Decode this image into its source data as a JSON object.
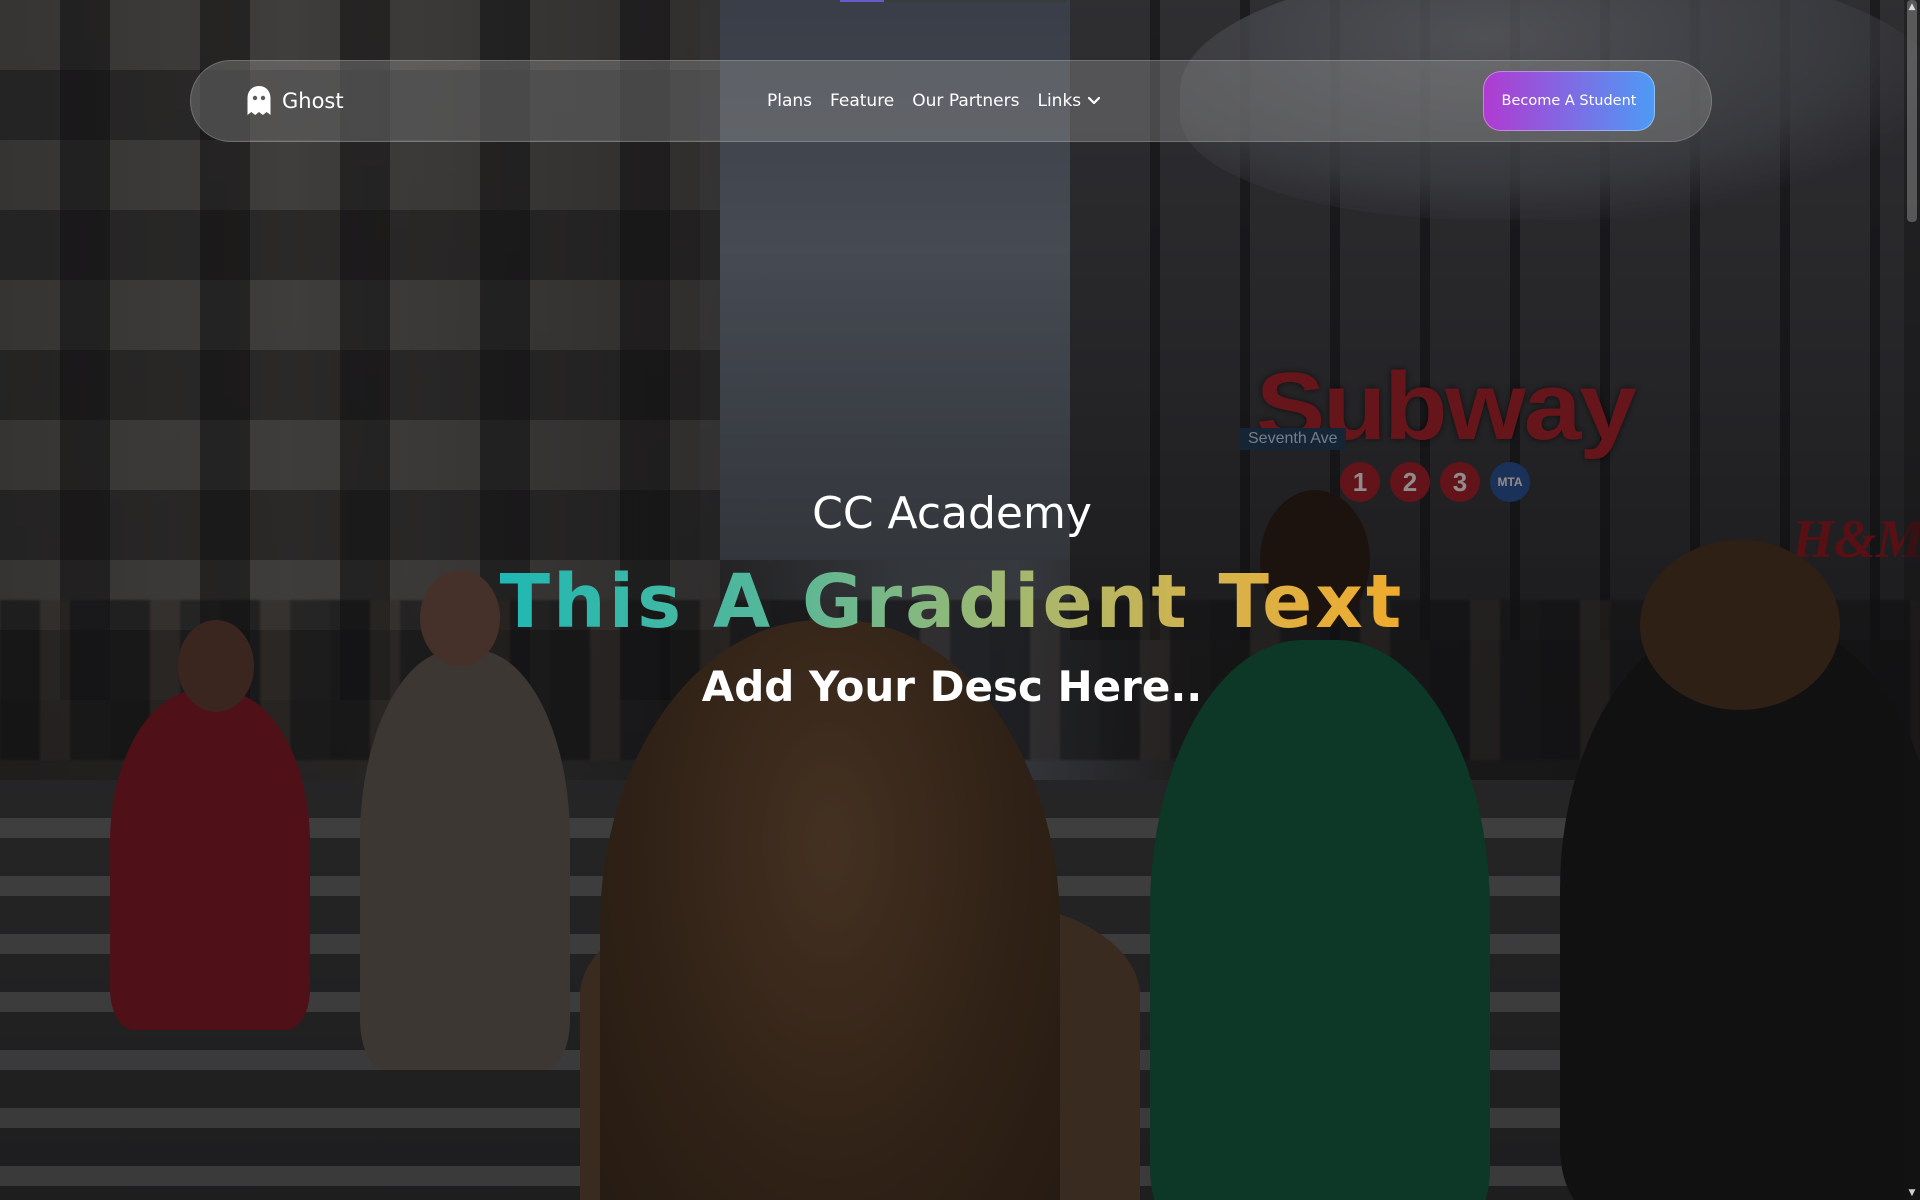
{
  "navbar": {
    "brand": {
      "name": "Ghost",
      "icon": "ghost-icon"
    },
    "links": [
      {
        "label": "Plans"
      },
      {
        "label": "Feature"
      },
      {
        "label": "Our Partners"
      },
      {
        "label": "Links",
        "icon": "chevron-down-icon"
      }
    ],
    "cta_label": "Become A Student"
  },
  "hero": {
    "subtitle": "CC Academy",
    "title": "This A Gradient Text",
    "description": "Add Your Desc Here.."
  },
  "background": {
    "sign_text": "Subway",
    "street_sign": "Seventh Ave",
    "line_numbers": [
      "1",
      "2",
      "3"
    ],
    "mta_badge": "MTA",
    "store_logo": "H&M"
  },
  "colors": {
    "cta_gradient_start": "#b13ad1",
    "cta_gradient_end": "#4d9bf5",
    "title_gradient_start": "#1fb8b4",
    "title_gradient_end": "#f0ab2c"
  }
}
